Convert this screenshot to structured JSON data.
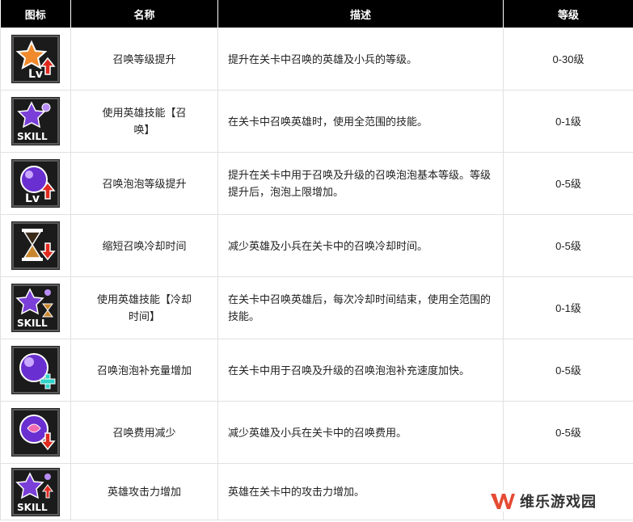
{
  "header": {
    "icon": "图标",
    "name": "名称",
    "desc": "描述",
    "level": "等级"
  },
  "rows": [
    {
      "icon": "star-level-up-icon",
      "name": "召唤等级提升",
      "desc": "提升在关卡中召唤的英雄及小兵的等级。",
      "level": "0-30级"
    },
    {
      "icon": "hero-skill-summon-icon",
      "name": "使用英雄技能【召唤】",
      "desc": "在关卡中召唤英雄时，使用全范围的技能。",
      "level": "0-1级"
    },
    {
      "icon": "bubble-level-up-icon",
      "name": "召唤泡泡等级提升",
      "desc": "提升在关卡中用于召唤及升级的召唤泡泡基本等级。等级提升后，泡泡上限增加。",
      "level": "0-5级"
    },
    {
      "icon": "hourglass-cooldown-down-icon",
      "name": "缩短召唤冷却时间",
      "desc": "减少英雄及小兵在关卡中的召唤冷却时间。",
      "level": "0-5级"
    },
    {
      "icon": "hero-skill-cooldown-icon",
      "name": "使用英雄技能【冷却时间】",
      "desc": "在关卡中召唤英雄后，每次冷却时间结束，使用全范围的技能。",
      "level": "0-1级"
    },
    {
      "icon": "bubble-charge-plus-icon",
      "name": "召唤泡泡补充量增加",
      "desc": "在关卡中用于召唤及升级的召唤泡泡补充速度加快。",
      "level": "0-5级"
    },
    {
      "icon": "bubble-cost-down-icon",
      "name": "召唤费用减少",
      "desc": "减少英雄及小兵在关卡中的召唤费用。",
      "level": "0-5级"
    },
    {
      "icon": "hero-skill-attack-up-icon",
      "name": "英雄攻击力增加",
      "desc": "英雄在关卡中的攻击力增加。",
      "level": ""
    }
  ],
  "watermark": {
    "text": "维乐游戏园",
    "icon": "w-logo-icon"
  },
  "colors": {
    "header_bg": "#000000",
    "border": "#e1e1e1",
    "red_arrow": "#e02a1f",
    "purple": "#7a3fd8",
    "orange": "#f08a2c",
    "teal": "#2fd3c8",
    "logo_red": "#e54b33"
  }
}
